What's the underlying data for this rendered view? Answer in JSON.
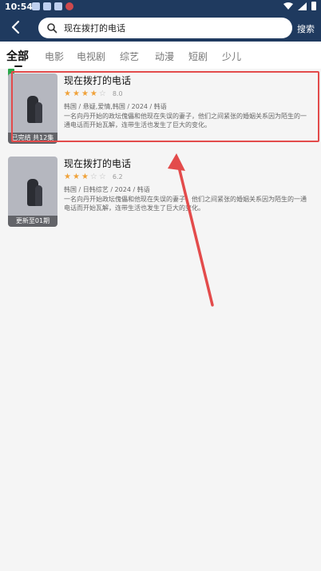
{
  "status_bar": {
    "time": "10:54"
  },
  "header": {
    "search_text": "现在拨打的电话",
    "search_button": "搜索"
  },
  "tabs": [
    {
      "label": "全部",
      "active": true
    },
    {
      "label": "电影"
    },
    {
      "label": "电视剧"
    },
    {
      "label": "综艺"
    },
    {
      "label": "动漫"
    },
    {
      "label": "短剧"
    },
    {
      "label": "少儿"
    }
  ],
  "results": [
    {
      "title": "现在拨打的电话",
      "rating": "8.0",
      "meta": "韩国 / 悬疑,爱情,韩国 / 2024 / 韩语",
      "description": "一名向丹开始的政坛傀儡和他现在失误的妻子，他们之间紧张的婚姻关系因为陌生的一通电话而开始瓦解，连带生活也发生了巨大的变化。",
      "poster_caption": "已完结 共12集",
      "highlighted": true
    },
    {
      "title": "现在拨打的电话",
      "rating": "6.2",
      "meta": "韩国 / 日韩综艺 / 2024 / 韩语",
      "description": "一名向丹开始政坛傀儡和他现在失误的妻子，他们之间紧张的婚姻关系因为陌生的一通电话而开始瓦解，连带生活也发生了巨大的变化。",
      "poster_caption": "更新至01期",
      "highlighted": false
    }
  ]
}
